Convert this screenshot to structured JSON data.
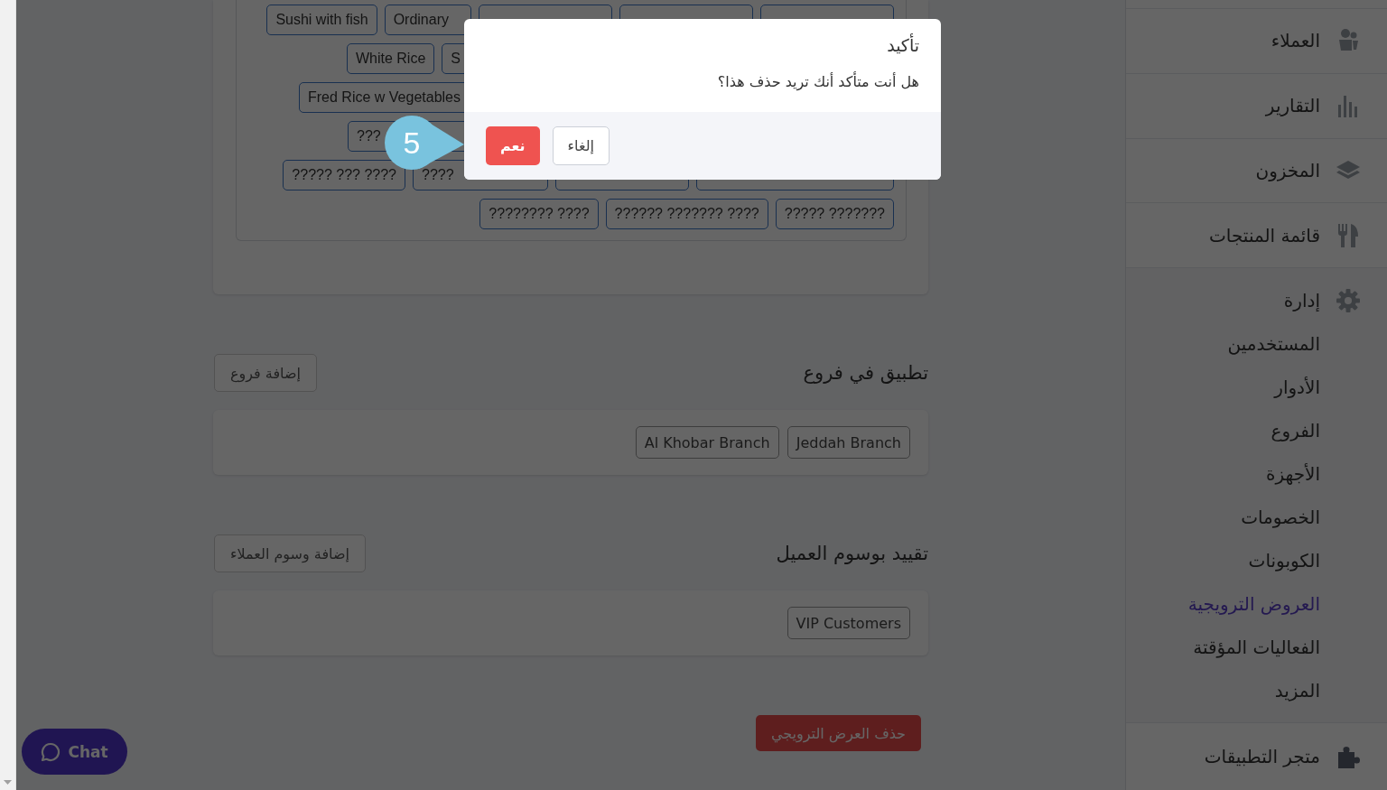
{
  "sidebar": {
    "items": [
      {
        "label": "العملاء"
      },
      {
        "label": "التقارير"
      },
      {
        "label": "المخزون"
      },
      {
        "label": "قائمة المنتجات"
      },
      {
        "label": "إدارة",
        "children": [
          {
            "label": "المستخدمين",
            "selected": false
          },
          {
            "label": "الأدوار",
            "selected": false
          },
          {
            "label": "الفروع",
            "selected": false
          },
          {
            "label": "الأجهزة",
            "selected": false
          },
          {
            "label": "الخصومات",
            "selected": false
          },
          {
            "label": "الكوبونات",
            "selected": false
          },
          {
            "label": "العروض الترويجية",
            "selected": true
          },
          {
            "label": "الفعاليات المؤقتة",
            "selected": false
          },
          {
            "label": "المزيد",
            "selected": false
          }
        ]
      },
      {
        "label": "متجر التطبيقات"
      }
    ]
  },
  "products_card": {
    "tag_rows": [
      {
        "partial": false,
        "tags": [
          {
            "kind": "covered"
          },
          {
            "kind": "covered"
          },
          {
            "kind": "covered"
          },
          {
            "kind": "partial",
            "label": "Ordinary"
          },
          {
            "kind": "full",
            "label": "Sushi with fish"
          }
        ]
      },
      {
        "partial": true,
        "tags": [
          {
            "kind": "partial",
            "label": "S"
          },
          {
            "kind": "full",
            "label": "White Rice"
          }
        ]
      },
      {
        "partial": true,
        "tags": [
          {
            "kind": "partial",
            "label": "Fred Rice w Vegetables"
          }
        ]
      },
      {
        "partial": true,
        "tags": [
          {
            "kind": "wide",
            "label": "???"
          }
        ]
      },
      {
        "partial": false,
        "tags": [
          {
            "kind": "covered-wide"
          },
          {
            "kind": "covered"
          },
          {
            "kind": "wide",
            "label": "????"
          },
          {
            "kind": "full",
            "label": "????? ??? ????"
          }
        ]
      },
      {
        "partial": false,
        "tags": [
          {
            "kind": "full",
            "label": "????? ???????"
          },
          {
            "kind": "full",
            "label": "?????? ??????? ????"
          },
          {
            "kind": "full",
            "label": "???????? ????"
          }
        ]
      }
    ]
  },
  "branches": {
    "title": "تطبيق في فروع",
    "add_button": "إضافة فروع",
    "tags": [
      "Jeddah Branch",
      "Al Khobar Branch"
    ]
  },
  "customer_tags": {
    "title": "تقييد بوسوم العميل",
    "add_button": "إضافة وسوم العملاء",
    "tags": [
      "VIP Customers"
    ]
  },
  "delete_button": "حذف العرض الترويجي",
  "chat_button": "Chat",
  "dialog": {
    "title": "تأكيد",
    "message": "هل أنت متأكد أنك تريد حذف هذا؟",
    "buttons": [
      {
        "kind": "cancel",
        "label": "إلغاء"
      },
      {
        "kind": "confirm",
        "label": "نعم"
      }
    ]
  },
  "step_marker": "5"
}
